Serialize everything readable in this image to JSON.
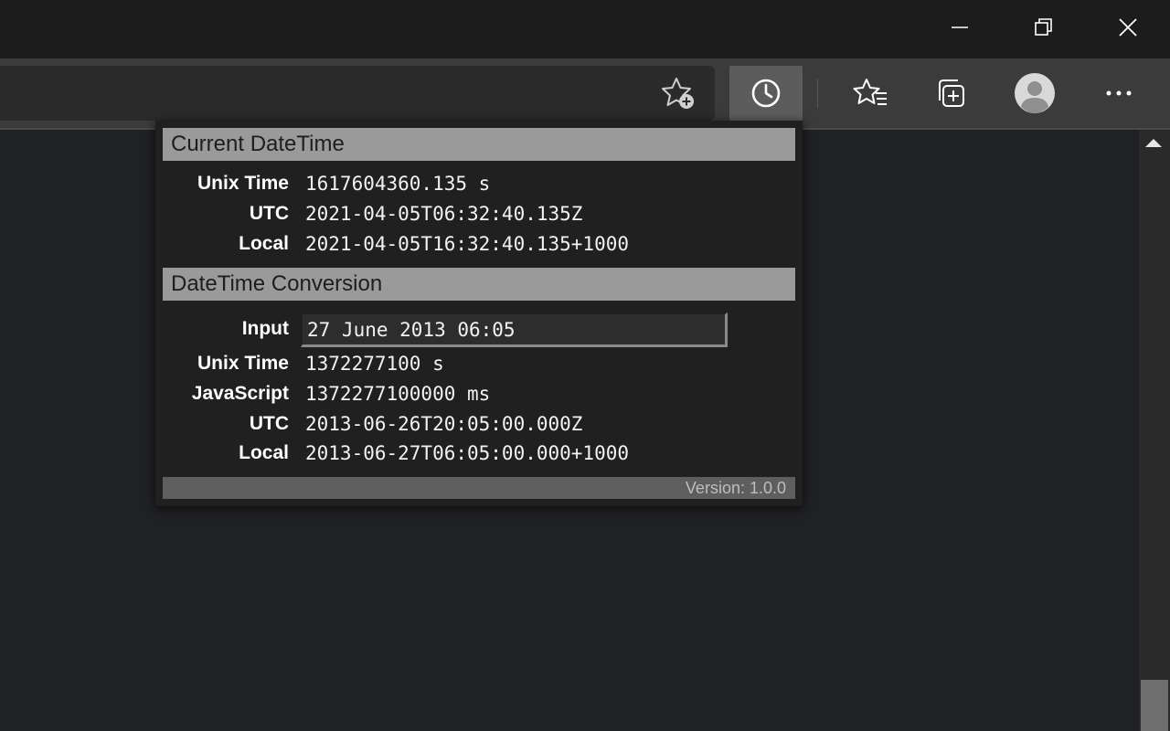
{
  "window": {
    "minimize_icon": "minimize-icon",
    "restore_icon": "restore-icon",
    "close_icon": "close-icon"
  },
  "toolbar": {
    "icons": [
      "add-favorite-icon",
      "clock-icon",
      "favorites-icon",
      "collections-icon",
      "profile-icon",
      "more-icon"
    ]
  },
  "popup": {
    "current": {
      "title": "Current DateTime",
      "rows": [
        {
          "label": "Unix Time",
          "value": "1617604360.135 s"
        },
        {
          "label": "UTC",
          "value": "2021-04-05T06:32:40.135Z"
        },
        {
          "label": "Local",
          "value": "2021-04-05T16:32:40.135+1000"
        }
      ]
    },
    "conversion": {
      "title": "DateTime Conversion",
      "input_label": "Input",
      "input_value": "27 June 2013 06:05",
      "rows": [
        {
          "label": "Unix Time",
          "value": "1372277100 s"
        },
        {
          "label": "JavaScript",
          "value": "1372277100000 ms"
        },
        {
          "label": "UTC",
          "value": "2013-06-26T20:05:00.000Z"
        },
        {
          "label": "Local",
          "value": "2013-06-27T06:05:00.000+1000"
        }
      ]
    },
    "version": "Version: 1.0.0"
  },
  "colors": {
    "header_bg": "#9a9a9a",
    "popup_bg": "#202020",
    "page_bg": "#202124"
  }
}
